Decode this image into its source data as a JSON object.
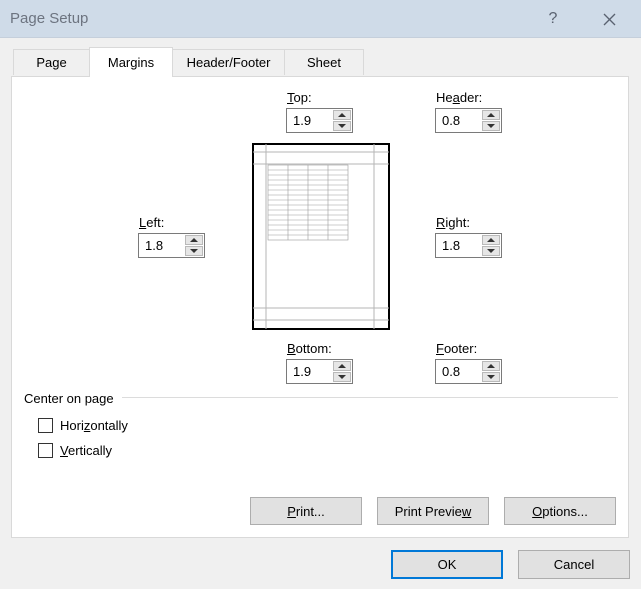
{
  "window": {
    "title": "Page Setup",
    "help_glyph": "?",
    "close_icon": "close-icon"
  },
  "tabs": [
    {
      "label": "Page",
      "active": false
    },
    {
      "label": "Margins",
      "active": true
    },
    {
      "label": "Header/Footer",
      "active": false
    },
    {
      "label": "Sheet",
      "active": false
    }
  ],
  "margins": {
    "top": {
      "label_pre": "",
      "label_key": "T",
      "label_post": "op:",
      "value": "1.9"
    },
    "header": {
      "label_pre": "He",
      "label_key": "a",
      "label_post": "der:",
      "value": "0.8"
    },
    "left": {
      "label_pre": "",
      "label_key": "L",
      "label_post": "eft:",
      "value": "1.8"
    },
    "right": {
      "label_pre": "",
      "label_key": "R",
      "label_post": "ight:",
      "value": "1.8"
    },
    "bottom": {
      "label_pre": "",
      "label_key": "B",
      "label_post": "ottom:",
      "value": "1.9"
    },
    "footer": {
      "label_pre": "",
      "label_key": "F",
      "label_post": "ooter:",
      "value": "0.8"
    }
  },
  "center_on_page": {
    "label": "Center on page",
    "horizontally": {
      "label_pre": "Hori",
      "label_key": "z",
      "label_post": "ontally",
      "checked": false
    },
    "vertically": {
      "label_pre": "",
      "label_key": "V",
      "label_post": "ertically",
      "checked": false
    }
  },
  "panel_buttons": {
    "print": {
      "label_pre": "",
      "label_key": "P",
      "label_post": "rint..."
    },
    "print_preview": {
      "label_pre": "Print Previe",
      "label_key": "w",
      "label_post": ""
    },
    "options": {
      "label_pre": "",
      "label_key": "O",
      "label_post": "ptions..."
    }
  },
  "footer_buttons": {
    "ok": "OK",
    "cancel": "Cancel"
  },
  "colors": {
    "titlebar": "#cfdbe8",
    "dialog_bg": "#f0f0f0",
    "panel_bg": "#ffffff",
    "default_button_border": "#0078d7"
  }
}
